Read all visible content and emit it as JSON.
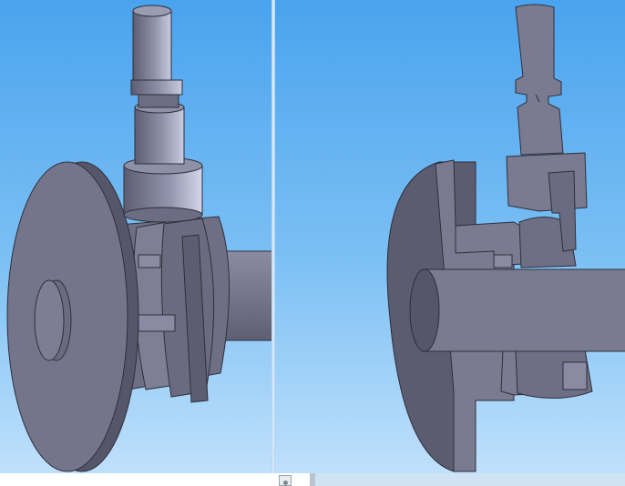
{
  "viewports": [
    {
      "name": "isometric-view",
      "content": "valve-assembly-exterior"
    },
    {
      "name": "section-view",
      "content": "valve-assembly-cross-section"
    }
  ],
  "colors": {
    "background_top": "#4aa3ee",
    "background_bottom": "#bfe0fb",
    "part_face": "#7a7b90",
    "part_shadow": "#55566a",
    "part_highlight": "#a9abc2",
    "edge": "#2e2f3a"
  },
  "bottom_bar": {
    "icon": "view-thumbnail-icon"
  }
}
